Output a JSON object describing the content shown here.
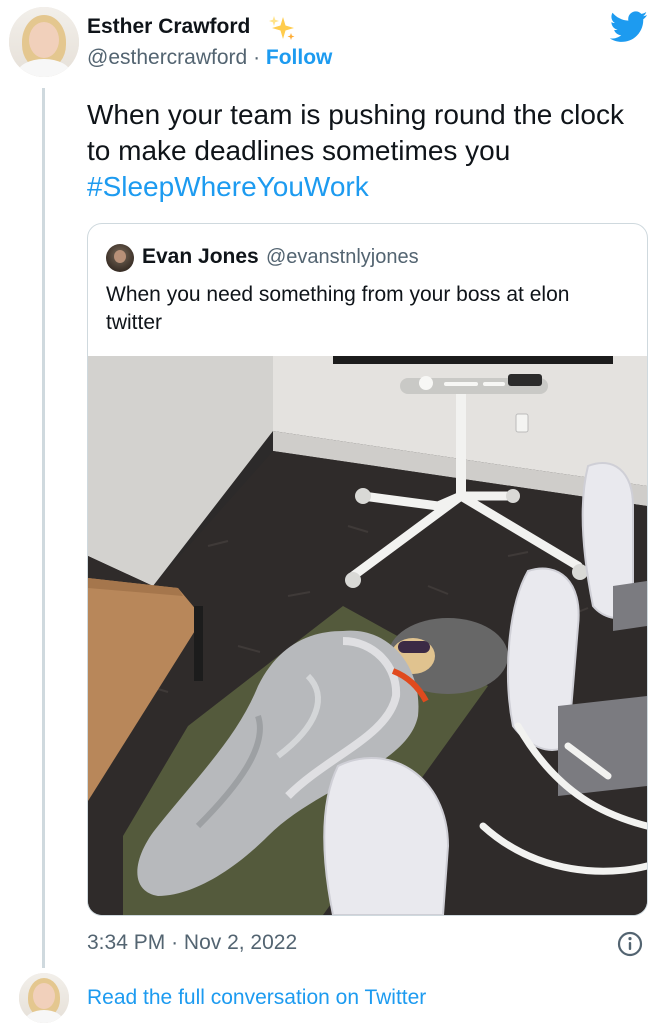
{
  "author": {
    "name": "Esther Crawford",
    "handle": "@esthercrawford",
    "separator": "·",
    "follow_label": "Follow"
  },
  "tweet": {
    "text": "When your team is pushing round the clock to make deadlines sometimes you",
    "hashtag": "#SleepWhereYouWork"
  },
  "quoted_tweet": {
    "name": "Evan Jones",
    "handle": "@evanstnlyjones",
    "text": "When you need something from your boss at elon twitter"
  },
  "meta": {
    "time": "3:34 PM",
    "separator": "·",
    "date": "Nov 2, 2022"
  },
  "footer": {
    "read_more": "Read the full conversation on Twitter"
  },
  "icons": {
    "brand": "twitter-bird-icon",
    "sparkle": "sparkles-emoji-icon",
    "info": "info-icon"
  },
  "colors": {
    "accent": "#1d9bf0",
    "text": "#0f1419",
    "secondary": "#536471",
    "border": "#cfd9de"
  }
}
